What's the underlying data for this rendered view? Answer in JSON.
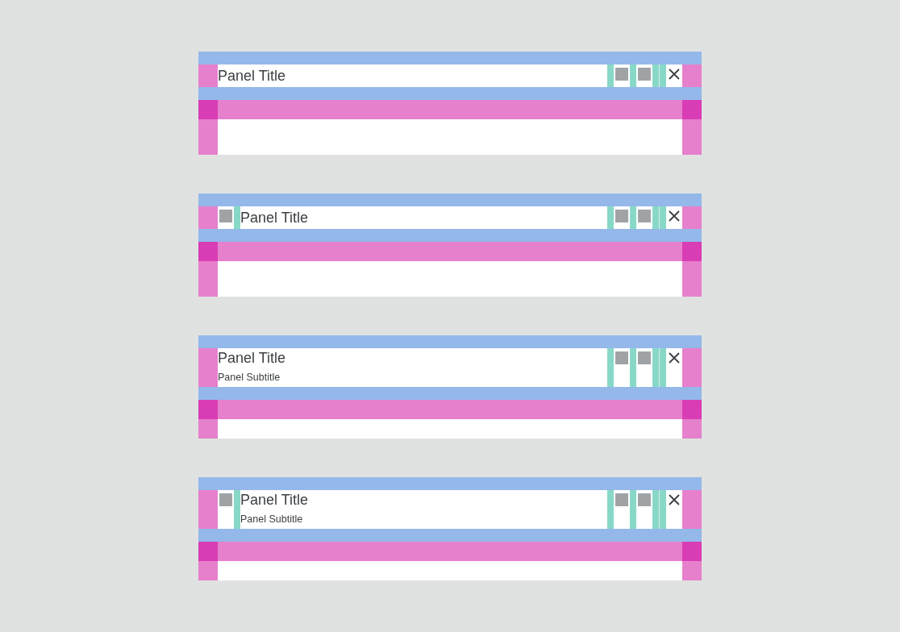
{
  "panels": [
    {
      "leading_icon": false,
      "title": "Panel Title"
    },
    {
      "leading_icon": true,
      "title": "Panel Title"
    },
    {
      "leading_icon": false,
      "title": "Panel Title",
      "subtitle": "Panel Subtitle"
    },
    {
      "leading_icon": true,
      "title": "Panel Title",
      "subtitle": "Panel Subtitle"
    }
  ]
}
